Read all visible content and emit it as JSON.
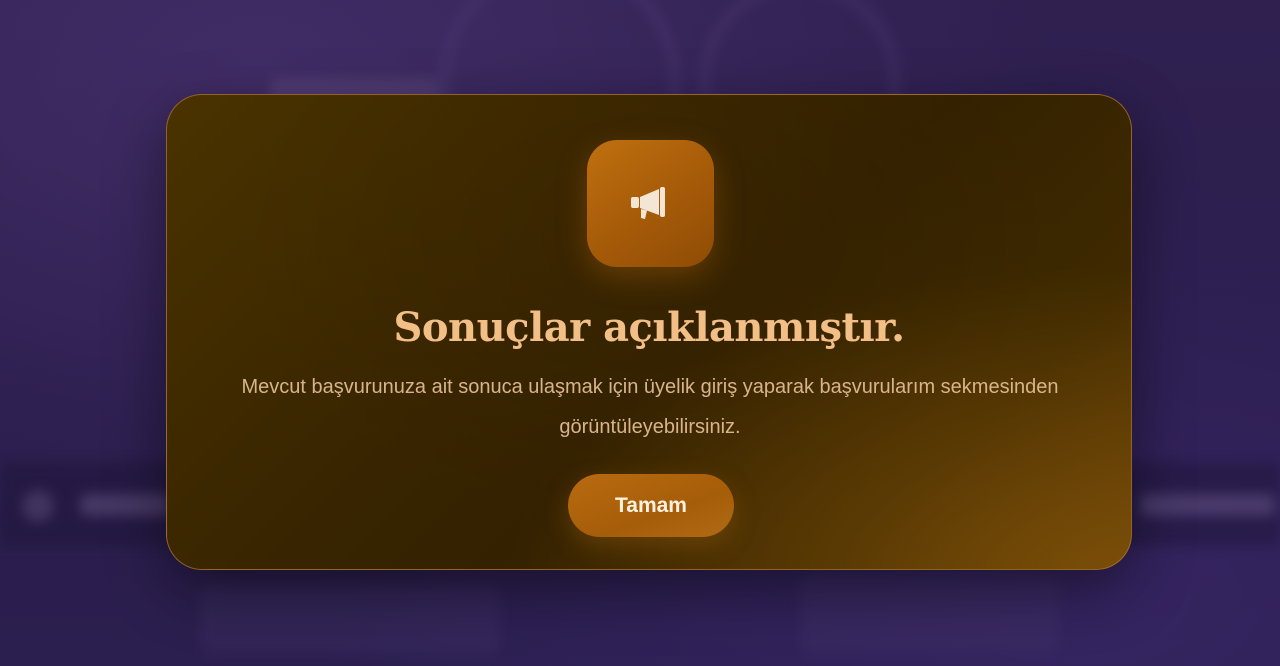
{
  "modal": {
    "icon": "megaphone-icon",
    "title": "Sonuçlar açıklanmıştır.",
    "message": "Mevcut başvurunuza ait sonuca ulaşmak için üyelik giriş yaparak başvurularım sekmesinden görüntüleyebilirsiniz.",
    "ok_label": "Tamam"
  },
  "colors": {
    "backdrop": "#2a1d4d",
    "modal_background": "#3a2600",
    "accent": "#b0650d",
    "title": "#f2bf87",
    "message": "#d8b48b",
    "button_text": "#fff2e0"
  }
}
